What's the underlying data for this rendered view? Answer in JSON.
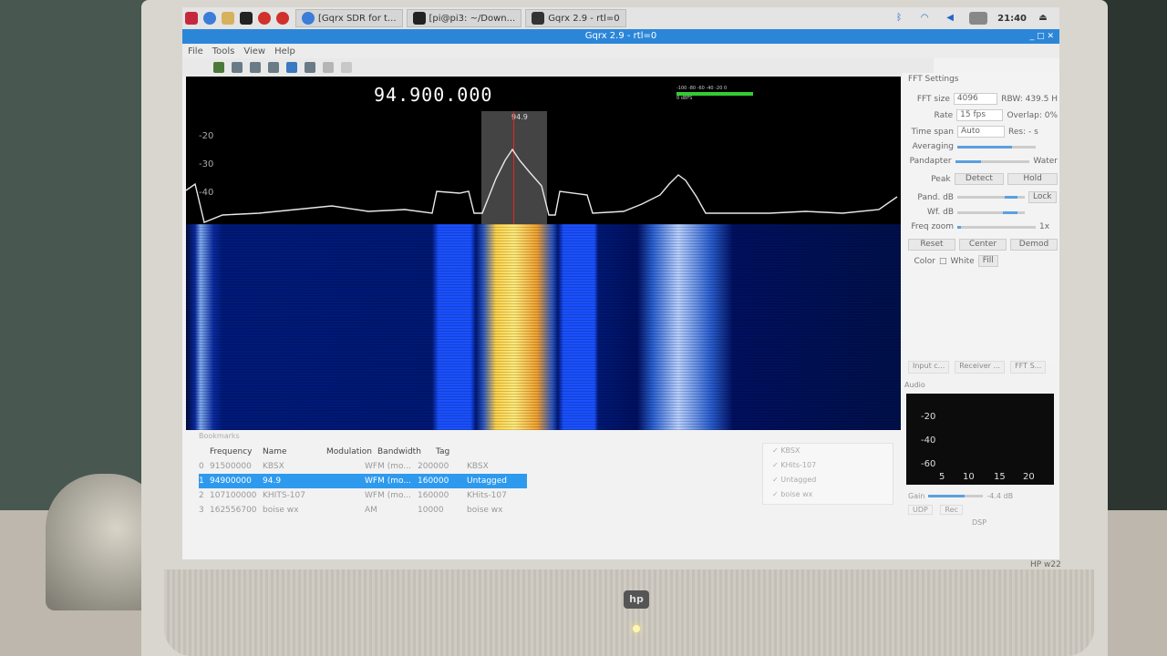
{
  "taskbar": {
    "tasks": [
      {
        "label": "[Gqrx SDR for t..."
      },
      {
        "label": "[pi@pi3: ~/Down..."
      },
      {
        "label": "Gqrx 2.9 - rtl=0"
      }
    ],
    "clock": "21:40"
  },
  "window": {
    "title": "Gqrx 2.9 - rtl=0"
  },
  "menu": {
    "items": [
      "File",
      "Tools",
      "View",
      "Help"
    ]
  },
  "plot": {
    "frequency": "94.900.000",
    "filter_label": "94.9",
    "db_ticks": [
      "-20",
      "-30",
      "-40"
    ],
    "meter_scale": "-100 -80 -60 -40 -20 0",
    "meter_unit": "0 dBFS"
  },
  "fft": {
    "title": "FFT Settings",
    "fft_size_label": "FFT size",
    "fft_size": "4096",
    "rbw": "RBW: 439.5 H",
    "rate_label": "Rate",
    "rate": "15 fps",
    "overlap": "Overlap: 0%",
    "timespan_label": "Time span",
    "timespan": "Auto",
    "res": "Res: - s",
    "averaging_label": "Averaging",
    "pandapter_label": "Pandapter",
    "water_label": "Water",
    "peak_label": "Peak",
    "detect_btn": "Detect",
    "hold_btn": "Hold",
    "pand_db_label": "Pand. dB",
    "lock_btn": "Lock",
    "wf_db_label": "Wf. dB",
    "freq_zoom_label": "Freq zoom",
    "zoom_value": "1x",
    "reset_btn": "Reset",
    "center_btn": "Center",
    "demod_btn": "Demod",
    "color_label": "Color",
    "white_label": "White",
    "fill_label": "Fill"
  },
  "dock_tabs": [
    "Input c...",
    "Receiver ...",
    "FFT S..."
  ],
  "audio": {
    "title": "Audio",
    "db_ticks": [
      "-20",
      "-40",
      "-60"
    ],
    "x_ticks": [
      "5",
      "10",
      "15",
      "20"
    ],
    "gain_label": "Gain",
    "gain_value": "-4.4 dB",
    "buttons": [
      "UDP",
      "Rec",
      "DSP"
    ]
  },
  "bookmarks": {
    "title": "Bookmarks",
    "headers": [
      "Frequency",
      "Name",
      "Modulation",
      "Bandwidth",
      "Tag"
    ],
    "rows": [
      {
        "idx": "0",
        "freq": "91500000",
        "name": "KBSX",
        "mod": "WFM (mo...",
        "bw": "200000",
        "tag": "KBSX",
        "selected": false
      },
      {
        "idx": "1",
        "freq": "94900000",
        "name": "94.9",
        "mod": "WFM (mo...",
        "bw": "160000",
        "tag": "Untagged",
        "selected": true
      },
      {
        "idx": "2",
        "freq": "107100000",
        "name": "KHITS-107",
        "mod": "WFM (mo...",
        "bw": "160000",
        "tag": "KHits-107",
        "selected": false
      },
      {
        "idx": "3",
        "freq": "162556700",
        "name": "boise wx",
        "mod": "AM",
        "bw": "10000",
        "tag": "boise wx",
        "selected": false
      }
    ],
    "tags": [
      "KBSX",
      "KHits-107",
      "Untagged",
      "boise wx"
    ]
  },
  "monitor": {
    "brand": "hp",
    "model": "HP w22"
  }
}
